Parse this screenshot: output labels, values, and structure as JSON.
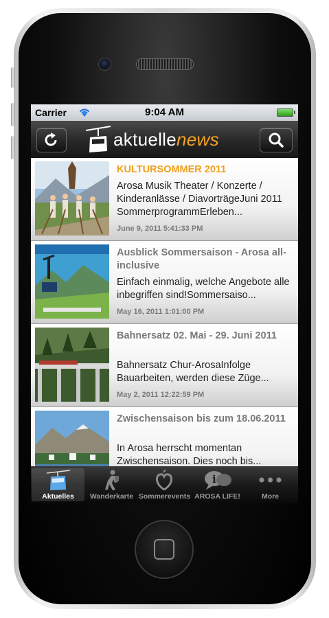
{
  "status_bar": {
    "carrier": "Carrier",
    "time": "9:04 AM"
  },
  "nav": {
    "logo_main": "aktuelle",
    "logo_accent": "news",
    "left_icon": "refresh-icon",
    "right_icon": "search-icon"
  },
  "colors": {
    "accent": "#f0a020",
    "title_gray": "#7a7a7a"
  },
  "news": [
    {
      "title": "KULTURSOMMER 2011",
      "body": "Arosa Musik Theater / Konzerte / Kinderanlässe / DiavorträgeJuni 2011 SommerprogrammErleben...",
      "date": "June 9, 2011 5:41:33 PM"
    },
    {
      "title": "Ausblick Sommersaison - Arosa all-inclusive",
      "body": "Einfach einmalig, welche Angebote alle inbegriffen sind!Sommersaiso...",
      "date": "May 16, 2011 1:01:00 PM"
    },
    {
      "title": "Bahnersatz 02. Mai - 29. Juni 2011",
      "body": "Bahnersatz Chur-ArosaInfolge Bauarbeiten, werden diese Züge...",
      "date": "May 2, 2011 12:22:59 PM"
    },
    {
      "title": "Zwischensaison bis zum 18.06.2011",
      "body": "In Arosa herrscht momentan Zwischensaison. Dies noch bis...",
      "date": ""
    }
  ],
  "tabs": [
    {
      "label": "Aktuelles",
      "icon": "cable-car-icon"
    },
    {
      "label": "Wanderkarte",
      "icon": "hiker-icon"
    },
    {
      "label": "Sommerevents",
      "icon": "heart-icon"
    },
    {
      "label": "AROSA LIFE!",
      "icon": "speech-bubble-icon"
    },
    {
      "label": "More",
      "icon": "more-dots-icon"
    }
  ]
}
